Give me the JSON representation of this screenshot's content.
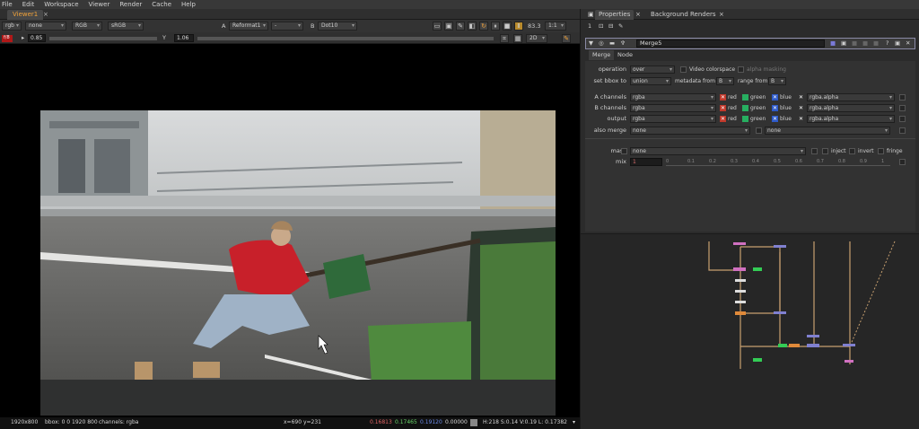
{
  "menu": [
    "File",
    "Edit",
    "Workspace",
    "Viewer",
    "Render",
    "Cache",
    "Help"
  ],
  "viewer": {
    "tab_label": "Viewer1",
    "tab_close": "×",
    "channels": "rgb",
    "alpha": "none",
    "layer": "RGB",
    "colorspace": "sRGB",
    "input_a_letter": "A",
    "input_a": "Reformat1",
    "input_sep": "-",
    "input_b_letter": "B",
    "input_b": "Dot10",
    "fps": "83.3",
    "zoom_ratio": "1:1",
    "gain_label": "f/8",
    "gain_value": "0.85",
    "gamma_label": "Y",
    "gamma_value": "1.06",
    "view_mode": "2D",
    "status": {
      "format": "1920x800",
      "bbox": "bbox: 0 0 1920 800",
      "channels": "channels: rgba",
      "coords": "x=690 y=231",
      "r": "0.16813",
      "g": "0.17465",
      "b": "0.19120",
      "a": "0.00000",
      "hsvl": "H:218 S:0.14 V:0.19  L: 0.17382"
    }
  },
  "properties": {
    "tab_label": "Properties",
    "tab_close": "×",
    "tab2_label": "Background Renders",
    "tab2_close": "×",
    "node_count": "1",
    "node_name": "Merge5",
    "subtab_merge": "Merge",
    "subtab_node": "Node",
    "operation_label": "operation",
    "operation_value": "over",
    "video_colorspace_label": "Video colorspace",
    "alpha_masking_label": "alpha masking",
    "set_bbox_label": "set bbox to",
    "set_bbox_value": "union",
    "metadata_label": "metadata from",
    "metadata_value": "B",
    "range_label": "range from",
    "range_value": "B",
    "a_channels_label": "A channels",
    "b_channels_label": "B channels",
    "output_label": "output",
    "channels_value": "rgba",
    "red_label": "red",
    "green_label": "green",
    "blue_label": "blue",
    "a_alpha": "rgba.alpha",
    "b_alpha": "rgba.alpha",
    "out_alpha": "rgba.alpha",
    "also_merge_label": "also merge",
    "also_merge_value": "none",
    "also_merge_value2": "none",
    "mask_label": "mask",
    "mask_value": "none",
    "inject_label": "inject",
    "invert_label": "invert",
    "fringe_label": "fringe",
    "mix_label": "mix",
    "mix_value": "1",
    "mix_ticks": [
      "0",
      "0.1",
      "0.2",
      "0.3",
      "0.4",
      "0.5",
      "0.6",
      "0.7",
      "0.8",
      "0.9",
      "1"
    ]
  },
  "colors": {
    "accent_orange": "#f0a23a",
    "red_chip": "#c0392b",
    "green_chip": "#27ae60",
    "blue_chip": "#2e5ac8",
    "node_line": "#c8a070",
    "node_purple": "#8080d0",
    "node_green": "#33cc55",
    "node_pink": "#d070c0"
  }
}
